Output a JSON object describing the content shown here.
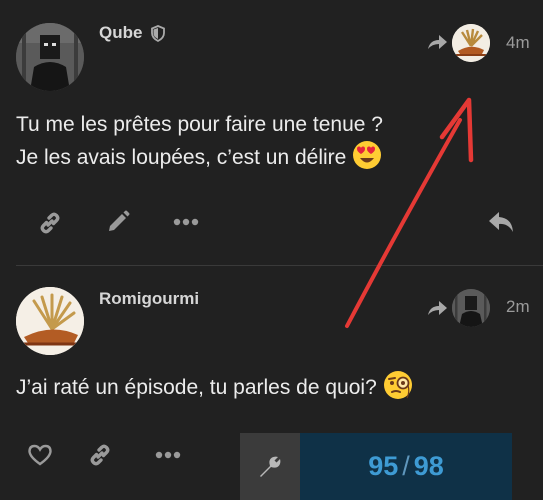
{
  "posts": [
    {
      "username": "Qube",
      "badge_icon": "shield-icon",
      "time": "4m",
      "lines": [
        "Tu me les prêtes pour faire une tenue ?",
        "Je les avais loupées, c’est un délire"
      ],
      "emoji": "😍",
      "actions": [
        "link-icon",
        "edit-icon",
        "more-icon",
        "reply-icon"
      ]
    },
    {
      "username": "Romigourmi",
      "time": "2m",
      "lines": [
        "J’ai raté un épisode, tu parles de quoi?"
      ],
      "emoji": "🧐",
      "actions": [
        "like-icon",
        "link-icon",
        "more-icon"
      ]
    }
  ],
  "progress": {
    "current": "95",
    "separator": "/",
    "total": "98"
  },
  "colors": {
    "background": "#212121",
    "annotation": "#e53935",
    "progress_bg": "#0f3147",
    "progress_text": "#3e9bd4"
  }
}
